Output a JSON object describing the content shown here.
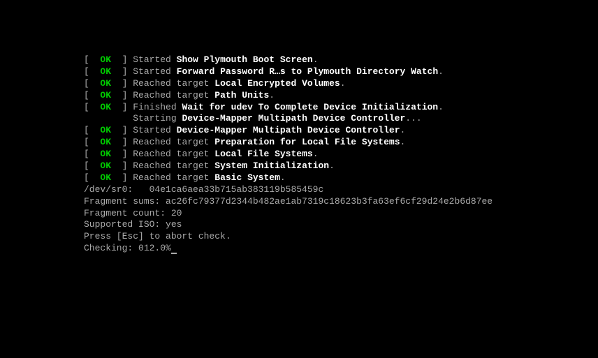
{
  "boot_lines": [
    {
      "status": "OK",
      "action": "Started",
      "desc": "Show Plymouth Boot Screen",
      "suffix": "."
    },
    {
      "status": "OK",
      "action": "Started",
      "desc": "Forward Password R…s to Plymouth Directory Watch",
      "suffix": "."
    },
    {
      "status": "OK",
      "action": "Reached target",
      "desc": "Local Encrypted Volumes",
      "suffix": "."
    },
    {
      "status": "OK",
      "action": "Reached target",
      "desc": "Path Units",
      "suffix": "."
    },
    {
      "status": "OK",
      "action": "Finished",
      "desc": "Wait for udev To Complete Device Initialization",
      "suffix": "."
    },
    {
      "status": "",
      "action": "Starting",
      "desc": "Device-Mapper Multipath Device Controller",
      "suffix": "..."
    },
    {
      "status": "OK",
      "action": "Started",
      "desc": "Device-Mapper Multipath Device Controller",
      "suffix": "."
    },
    {
      "status": "OK",
      "action": "Reached target",
      "desc": "Preparation for Local File Systems",
      "suffix": "."
    },
    {
      "status": "OK",
      "action": "Reached target",
      "desc": "Local File Systems",
      "suffix": "."
    },
    {
      "status": "OK",
      "action": "Reached target",
      "desc": "System Initialization",
      "suffix": "."
    },
    {
      "status": "OK",
      "action": "Reached target",
      "desc": "Basic System",
      "suffix": "."
    }
  ],
  "info_lines": [
    "/dev/sr0:   04e1ca6aea33b715ab383119b585459c",
    "Fragment sums: ac26fc79377d2344b482ae1ab7319c18623b3fa63ef6cf29d24e2b6d87ee",
    "Fragment count: 20",
    "Supported ISO: yes",
    "Press [Esc] to abort check."
  ],
  "checking_prefix": "Checking: ",
  "checking_value": "012.0%"
}
